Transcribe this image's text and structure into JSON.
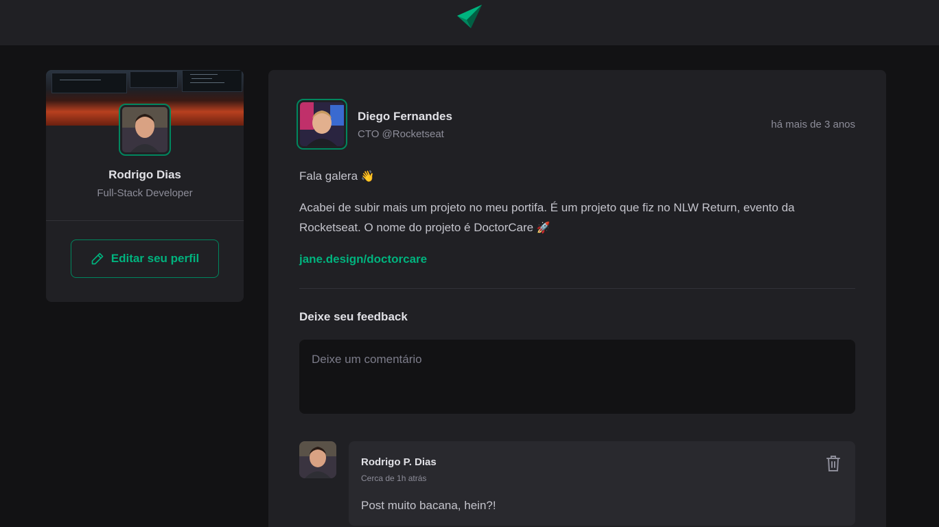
{
  "colors": {
    "background": "#121214",
    "surface": "#202024",
    "accent": "#00b37e",
    "accent_border": "#00875f"
  },
  "header": {
    "logo_icon": "paper-plane-logo-icon"
  },
  "profile": {
    "name": "Rodrigo Dias",
    "role": "Full-Stack Developer",
    "edit_label": "Editar seu perfil",
    "edit_icon": "pencil-icon"
  },
  "post": {
    "author_name": "Diego Fernandes",
    "author_role": "CTO @Rocketseat",
    "published": "há mais de 3 anos",
    "greeting": "Fala galera",
    "greeting_emoji": "👋",
    "body": "Acabei de subir mais um projeto no meu portifa. É um projeto que fiz no NLW Return, evento da Rocketseat. O nome do projeto é DoctorCare",
    "body_emoji": "🚀",
    "link": "jane.design/doctorcare"
  },
  "feedback": {
    "title": "Deixe seu feedback",
    "placeholder": "Deixe um comentário"
  },
  "comments": [
    {
      "author": "Rodrigo P. Dias",
      "time": "Cerca de 1h atrás",
      "text": "Post muito bacana, hein?!",
      "delete_icon": "trash-icon"
    }
  ]
}
